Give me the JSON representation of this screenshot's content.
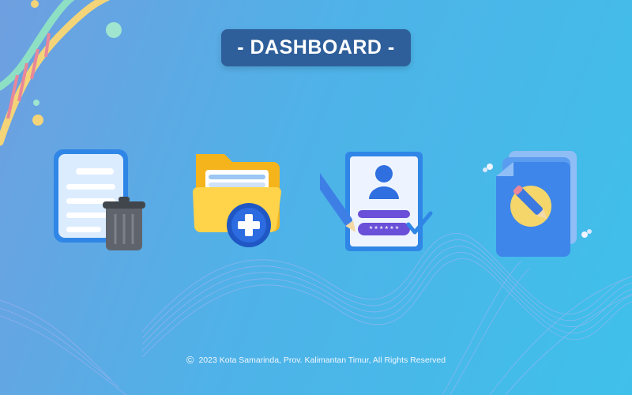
{
  "header": {
    "title": "- DASHBOARD -"
  },
  "tiles": [
    {
      "icon": "document-trash-icon"
    },
    {
      "icon": "folder-add-icon"
    },
    {
      "icon": "user-account-icon",
      "password_mask": "******"
    },
    {
      "icon": "files-edit-icon"
    }
  ],
  "footer": {
    "copyright_symbol": "©",
    "text": "2023 Kota Samarinda, Prov. Kalimantan Timur, All Rights Reserved"
  },
  "colors": {
    "background_start": "#6f9fe0",
    "background_end": "#3fc0ea",
    "title_pill": "#2f5f9a"
  }
}
